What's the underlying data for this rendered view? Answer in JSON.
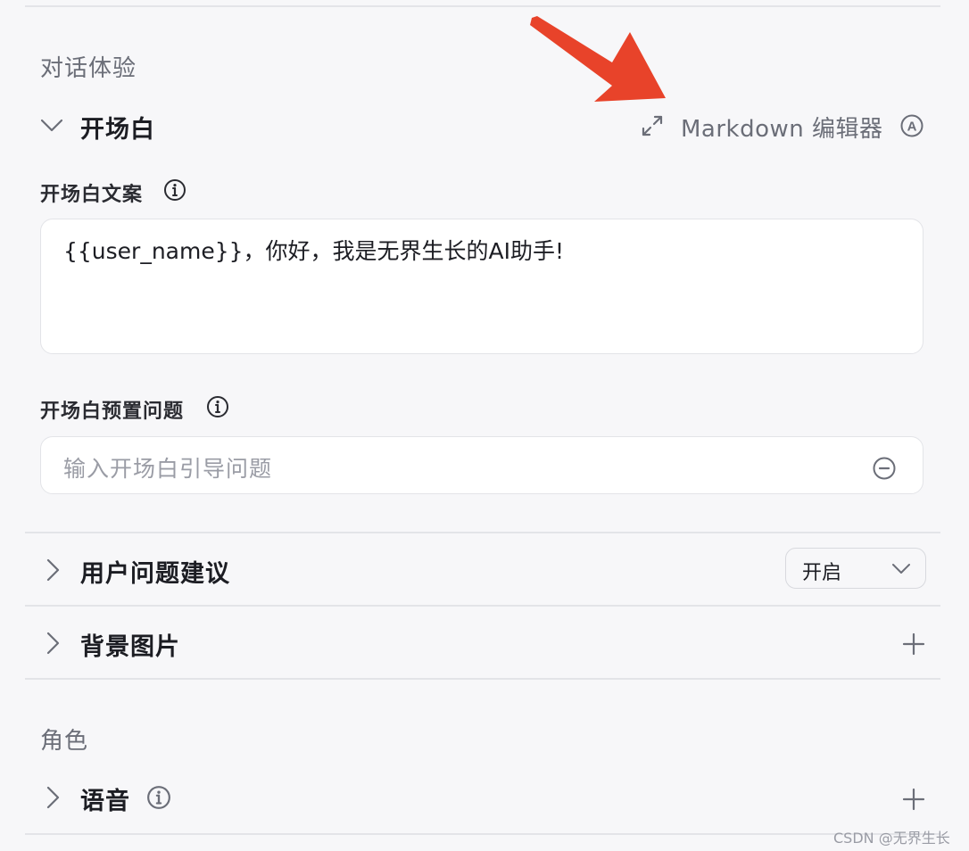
{
  "sections": {
    "dialog_experience": "对话体验",
    "role": "角色"
  },
  "opening": {
    "title": "开场白",
    "markdown_editor": "Markdown 编辑器",
    "copy_label": "开场白文案",
    "copy_text": "{{user_name}}，你好，我是无界生长的AI助手!",
    "preset_label": "开场白预置问题",
    "preset_placeholder": "输入开场白引导问题"
  },
  "suggestions": {
    "title": "用户问题建议",
    "select_value": "开启"
  },
  "background": {
    "title": "背景图片"
  },
  "voice": {
    "title": "语音"
  },
  "watermark": "CSDN @无界生长",
  "colors": {
    "annotation_arrow": "#e8432a",
    "page_bg": "#f7f7f9",
    "text_muted": "#6b6e78"
  },
  "icons": {
    "expand": "expand-arrows-icon",
    "auto": "circle-a-icon",
    "info": "info-circle-icon",
    "remove": "minus-circle-icon",
    "add": "plus-icon"
  }
}
